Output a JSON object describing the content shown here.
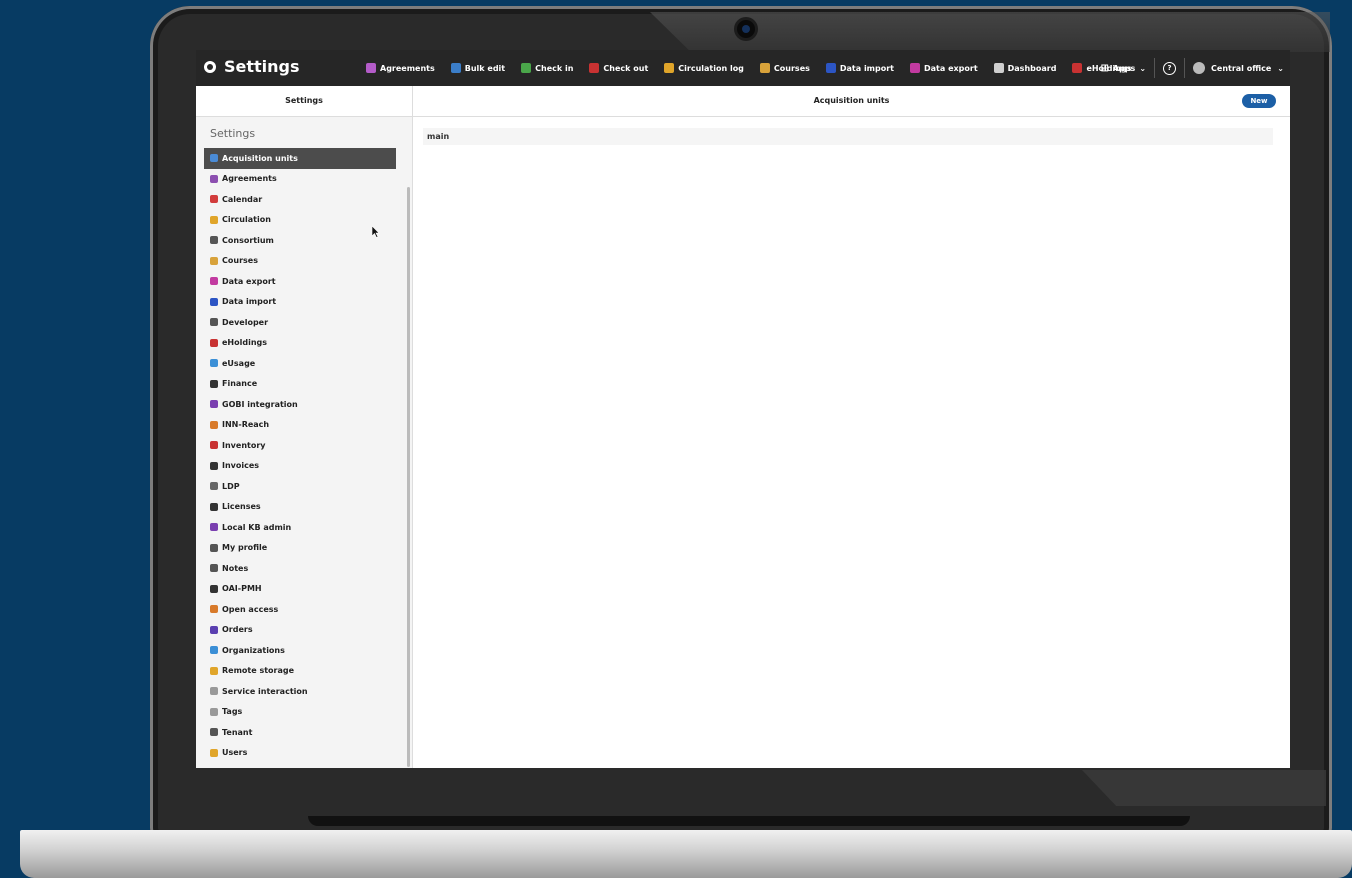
{
  "topbar": {
    "title": "Settings",
    "apps": [
      {
        "label": "Agreements",
        "icon": "agreements-icon",
        "color": "#b45cc9"
      },
      {
        "label": "Bulk edit",
        "icon": "bulk-edit-icon",
        "color": "#3b7ec9"
      },
      {
        "label": "Check in",
        "icon": "check-in-icon",
        "color": "#4aa64a"
      },
      {
        "label": "Check out",
        "icon": "check-out-icon",
        "color": "#c83232"
      },
      {
        "label": "Circulation log",
        "icon": "circulation-log-icon",
        "color": "#e0a52a"
      },
      {
        "label": "Courses",
        "icon": "courses-icon",
        "color": "#d8a23a"
      },
      {
        "label": "Data import",
        "icon": "data-import-icon",
        "color": "#2c55c4"
      },
      {
        "label": "Data export",
        "icon": "data-export-icon",
        "color": "#c23aa0"
      },
      {
        "label": "Dashboard",
        "icon": "dashboard-icon",
        "color": "#cfcfcf"
      },
      {
        "label": "eHoldings",
        "icon": "eholdings-icon",
        "color": "#c83232"
      }
    ],
    "apps_menu_label": "Apps",
    "help_symbol": "?",
    "user_label": "Central office"
  },
  "panes": {
    "left_header": "Settings",
    "right_header": "Acquisition units",
    "new_button": "New"
  },
  "sidebar": {
    "title": "Settings",
    "items": [
      {
        "label": "Acquisition units",
        "color": "#4a8bd6",
        "active": true
      },
      {
        "label": "Agreements",
        "color": "#8c4fb0"
      },
      {
        "label": "Calendar",
        "color": "#d23c3c"
      },
      {
        "label": "Circulation",
        "color": "#e0a52a"
      },
      {
        "label": "Consortium",
        "color": "#555555"
      },
      {
        "label": "Courses",
        "color": "#d8a23a"
      },
      {
        "label": "Data export",
        "color": "#c23aa0"
      },
      {
        "label": "Data import",
        "color": "#2c55c4"
      },
      {
        "label": "Developer",
        "color": "#555555"
      },
      {
        "label": "eHoldings",
        "color": "#c83232"
      },
      {
        "label": "eUsage",
        "color": "#3b8fd6"
      },
      {
        "label": "Finance",
        "color": "#333333"
      },
      {
        "label": "GOBI integration",
        "color": "#7a3fb0"
      },
      {
        "label": "INN-Reach",
        "color": "#d87a2a"
      },
      {
        "label": "Inventory",
        "color": "#c83232"
      },
      {
        "label": "Invoices",
        "color": "#333333"
      },
      {
        "label": "LDP",
        "color": "#666666"
      },
      {
        "label": "Licenses",
        "color": "#333333"
      },
      {
        "label": "Local KB admin",
        "color": "#7a3fb0"
      },
      {
        "label": "My profile",
        "color": "#555555"
      },
      {
        "label": "Notes",
        "color": "#555555"
      },
      {
        "label": "OAI-PMH",
        "color": "#333333"
      },
      {
        "label": "Open access",
        "color": "#d87a2a"
      },
      {
        "label": "Orders",
        "color": "#5a3fb0"
      },
      {
        "label": "Organizations",
        "color": "#3b8fd6"
      },
      {
        "label": "Remote storage",
        "color": "#e0a52a"
      },
      {
        "label": "Service interaction",
        "color": "#999999"
      },
      {
        "label": "Tags",
        "color": "#999999"
      },
      {
        "label": "Tenant",
        "color": "#555555"
      },
      {
        "label": "Users",
        "color": "#e0a52a"
      }
    ]
  },
  "main": {
    "rows": [
      "main"
    ]
  }
}
